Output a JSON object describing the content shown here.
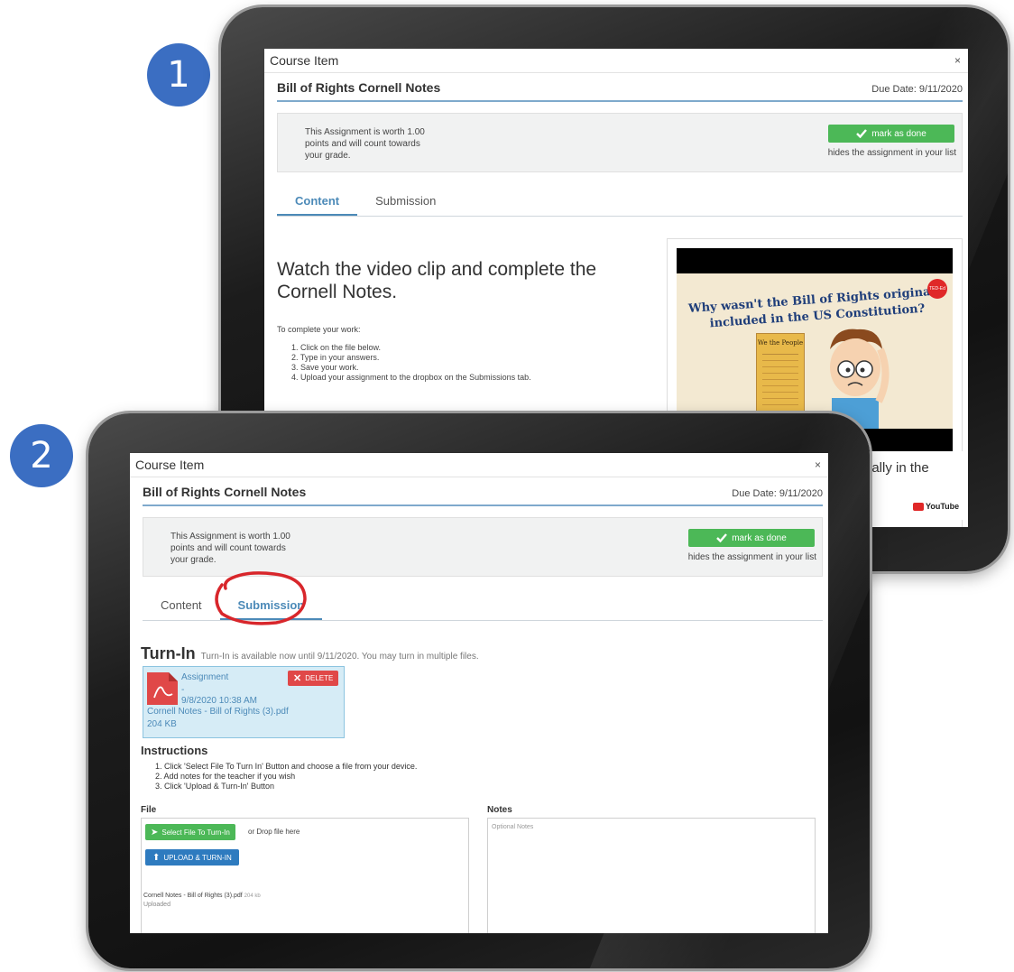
{
  "badges": [
    "1",
    "2"
  ],
  "window": {
    "title": "Course Item",
    "close": "×"
  },
  "assignment": {
    "title": "Bill of Rights Cornell Notes",
    "due": "Due Date: 9/11/2020",
    "worth": "This Assignment is worth 1.00 points and will count towards your grade.",
    "mark_done": "mark as done",
    "hides": "hides the assignment in your list"
  },
  "tabs": {
    "content": "Content",
    "submission": "Submission"
  },
  "content": {
    "heading": "Watch the video clip and complete the Cornell Notes.",
    "intro": "To complete your work:",
    "steps": [
      "1. Click on the file below.",
      "2. Type in your answers.",
      "3. Save your work.",
      "4. Upload your assignment to the dropbox on the Submissions tab."
    ]
  },
  "video": {
    "line1": "Why wasn't the Bill of Rights originally",
    "line2": "included in the US Constitution?",
    "doc_label": "We the People",
    "ted_badge": "TED-Ed",
    "caption": "nally in the",
    "youtube": "YouTube"
  },
  "turnin": {
    "heading": "Turn-In",
    "note": "Turn-In is available now until 9/11/2020. You may turn in multiple files.",
    "file": {
      "name": "Assignment",
      "dash": "-",
      "date": "9/8/2020 10:38 AM",
      "filename": "Cornell Notes - Bill of Rights (3).pdf",
      "size": "204 KB",
      "delete": "DELETE"
    }
  },
  "instructions": {
    "heading": "Instructions",
    "steps": [
      "1. Click 'Select File To Turn In' Button and choose a file from your device.",
      "2. Add notes for the teacher if you wish",
      "3. Click 'Upload & Turn-In' Button"
    ]
  },
  "fields": {
    "file_label": "File",
    "notes_label": "Notes",
    "select_btn": "Select File To Turn-In",
    "drop_text": "or Drop file here",
    "upload_btn": "UPLOAD & TURN-IN",
    "uploaded_name": "Cornell Notes - Bill of Rights (3).pdf",
    "uploaded_size": "204 kb",
    "uploaded_status": "Uploaded",
    "notes_placeholder": "Optional Notes"
  },
  "colors": {
    "accent": "#4c8ab8",
    "green": "#4cb857",
    "badge": "#3b6ec2",
    "delete": "#e04848",
    "upload": "#2e7bbf",
    "annotation": "#d8262b"
  }
}
